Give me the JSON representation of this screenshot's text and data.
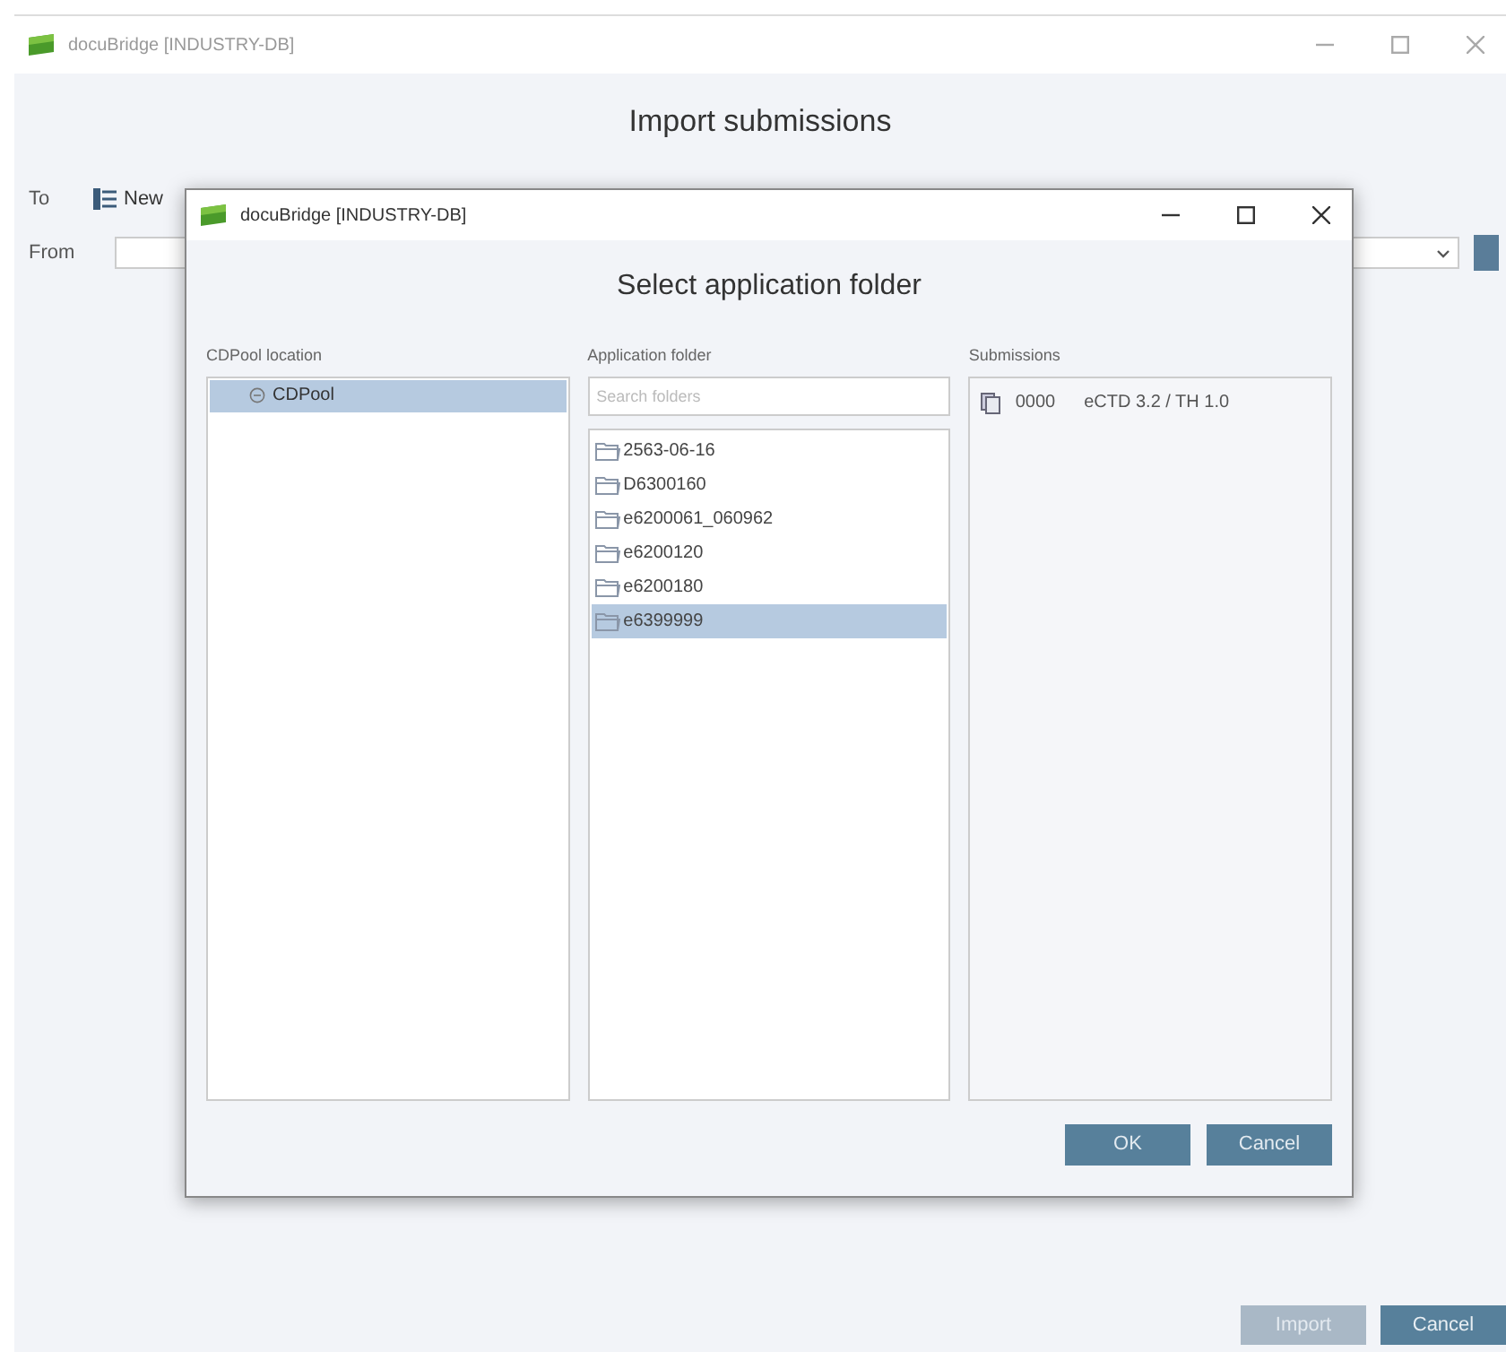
{
  "window": {
    "title": "docuBridge [INDUSTRY-DB]",
    "heading": "Import submissions"
  },
  "to": {
    "label": "To",
    "value": "New"
  },
  "from": {
    "label": "From"
  },
  "buttons": [
    {
      "label": "Import",
      "disabled": true
    },
    {
      "label": "Cancel",
      "disabled": false
    }
  ],
  "dialog": {
    "title": "docuBridge [INDUSTRY-DB]",
    "heading": "Select application folder",
    "location": {
      "label": "CDPool location",
      "items": [
        {
          "label": "CDPool",
          "selected": true
        }
      ]
    },
    "folders": {
      "label": "Application folder",
      "placeholder": "Search folders",
      "items": [
        {
          "label": "2563-06-16",
          "selected": false
        },
        {
          "label": "D6300160",
          "selected": false
        },
        {
          "label": "e6200061_060962",
          "selected": false
        },
        {
          "label": "e6200120",
          "selected": false
        },
        {
          "label": "e6200180",
          "selected": false
        },
        {
          "label": "e6399999",
          "selected": true
        }
      ]
    },
    "submissions": {
      "label": "Submissions",
      "items": [
        {
          "number": "0000",
          "format": "eCTD 3.2 / TH 1.0"
        }
      ]
    },
    "buttons": [
      {
        "label": "OK"
      },
      {
        "label": "Cancel"
      }
    ]
  }
}
